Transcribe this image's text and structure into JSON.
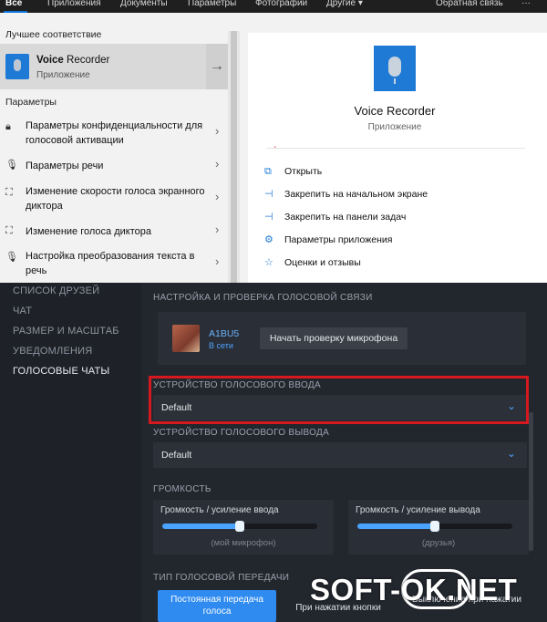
{
  "search_tabs": {
    "all": "Все",
    "apps": "Приложения",
    "docs": "Документы",
    "settings": "Параметры",
    "photos": "Фотографии",
    "other": "Другие",
    "feedback": "Обратная связь",
    "more": "···"
  },
  "best_match": {
    "heading": "Лучшее соответствие",
    "name_bold": "Voice",
    "name_rest": " Recorder",
    "type": "Приложение"
  },
  "settings_section": {
    "heading": "Параметры",
    "items": [
      {
        "label": "Параметры конфиденциальности для голосовой активации",
        "icon": "lock-icon"
      },
      {
        "label": "Параметры речи",
        "icon": "microphone-icon"
      },
      {
        "label": "Изменение скорости голоса экранного диктора",
        "icon": "narrator-icon"
      },
      {
        "label": "Изменение голоса диктора",
        "icon": "narrator-icon"
      },
      {
        "label": "Настройка преобразования текста в речь",
        "icon": "microphone-icon"
      }
    ]
  },
  "detail": {
    "title": "Voice Recorder",
    "subtitle": "Приложение",
    "actions": [
      {
        "label": "Открыть",
        "icon": "open-icon"
      },
      {
        "label": "Закрепить на начальном экране",
        "icon": "pin-icon"
      },
      {
        "label": "Закрепить на панели задач",
        "icon": "pin-icon"
      },
      {
        "label": "Параметры приложения",
        "icon": "gear-icon"
      },
      {
        "label": "Оценки и отзывы",
        "icon": "star-icon"
      }
    ]
  },
  "voice_nav": {
    "items": [
      "СПИСОК ДРУЗЕЙ",
      "ЧАТ",
      "РАЗМЕР И МАСШТАБ",
      "УВЕДОМЛЕНИЯ",
      "ГОЛОСОВЫЕ ЧАТЫ"
    ],
    "active_index": 4
  },
  "voice_settings": {
    "check_heading": "НАСТРОЙКА И ПРОВЕРКА ГОЛОСОВОЙ СВЯЗИ",
    "user_name": "A1BU5",
    "user_status": "В сети",
    "mic_test_button": "Начать проверку микрофона",
    "input_device_label": "УСТРОЙСТВО ГОЛОСОВОГО ВВОДА",
    "input_device_value": "Default",
    "output_device_label": "УСТРОЙСТВО ГОЛОСОВОГО ВЫВОДА",
    "output_device_value": "Default",
    "volume_label": "ГРОМКОСТЬ",
    "input_volume_label": "Громкость / усиление ввода",
    "input_volume_hint": "(мой микрофон)",
    "input_volume_level": 0.5,
    "output_volume_label": "Громкость / усиление вывода",
    "output_volume_hint": "(друзья)",
    "output_volume_level": 0.5,
    "transmission_label": "ТИП ГОЛОСОВОЙ ПЕРЕДАЧИ",
    "modes": [
      "Постоянная передача голоса",
      "При нажатии кнопки",
      "Выключение при нажатии"
    ],
    "active_mode": 0
  },
  "watermark": "SOFT-OK.NET",
  "colors": {
    "accent_blue": "#2f8bf0",
    "highlight_red": "#d6181f",
    "win_accent": "#1f7ad6"
  }
}
